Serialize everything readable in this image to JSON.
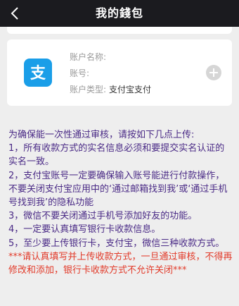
{
  "header": {
    "title": "我的錢包"
  },
  "account": {
    "name_label": "账户名称:",
    "name_value": "",
    "number_label": "账号:",
    "number_value": "",
    "type_label": "账户类型:",
    "type_value": "支付宝支付",
    "logo_char": "支"
  },
  "notice": {
    "intro": "为确保能一次性通过审核，请按如下几点上传:",
    "items": [
      "1，所有收款方式的实名信息必须和要提交实名认证的实名一致。",
      "2，支付宝账号一定要确保输入账号能进行付款操作，不要关闭支付宝应用中的‘通过邮箱找到我’或‘通过手机号找到我’的隐私功能",
      "3，微信不要关闭通过手机号添加好友的功能。",
      "4，一定要认真填写银行卡收款信息。",
      "5，至少要上传银行卡，支付宝，微信三种收款方式。"
    ],
    "warning": "***请认真填写并上传收款方式，一旦通过审核，不得再修改和添加，银行卡收款方式不允许关闭***"
  },
  "colors": {
    "header_bg": "#1b1b1f",
    "alipay_blue": "#1a9ee8",
    "notice_text": "#4a2a86",
    "warning_text": "#e23b2a"
  }
}
